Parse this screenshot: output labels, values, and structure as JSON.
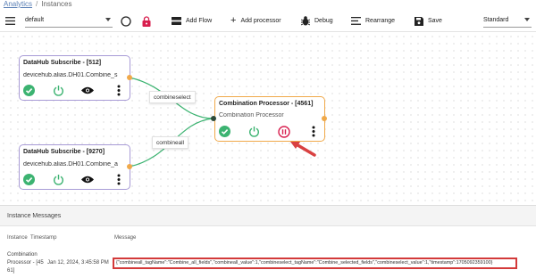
{
  "breadcrumb": {
    "parent": "Analytics",
    "separator": "/",
    "current": "Instances"
  },
  "toolbar": {
    "dataset_value": "default",
    "add_flow": "Add Flow",
    "add_processor": "Add processor",
    "debug": "Debug",
    "rearrange": "Rearrange",
    "save": "Save",
    "view_mode": "Standard"
  },
  "nodes": {
    "sub1": {
      "title": "DataHub Subscribe - [512]",
      "subtitle": "devicehub.alias.DH01.Combine_s"
    },
    "sub2": {
      "title": "DataHub Subscribe - [9270]",
      "subtitle": "devicehub.alias.DH01.Combine_a"
    },
    "proc": {
      "title": "Combination Processor - [4561]",
      "subtitle": "Combination Processor"
    }
  },
  "edges": {
    "label1": "combineselect",
    "label2": "combineall"
  },
  "messages": {
    "title": "Instance Messages",
    "columns": {
      "instance": "Instance",
      "timestamp": "Timestamp",
      "message": "Message"
    },
    "row": {
      "instance_line1": "Combination",
      "instance_line2": "Processor - [45",
      "instance_line3": "61]",
      "timestamp": "Jan 12, 2024, 3:45:58 PM",
      "message": "{\"combineall_tagName\":\"Combine_all_fields\",\"combineall_value\":1,\"combineselect_tagName\":\"Combine_selected_fields\",\"combineselect_value\":1,\"timestamp\":1705092359100}"
    }
  },
  "colors": {
    "success": "#3cb371",
    "danger": "#d81e4e",
    "accent": "#f0a94a",
    "purple": "#a89bd6",
    "arrow": "#d94141"
  }
}
